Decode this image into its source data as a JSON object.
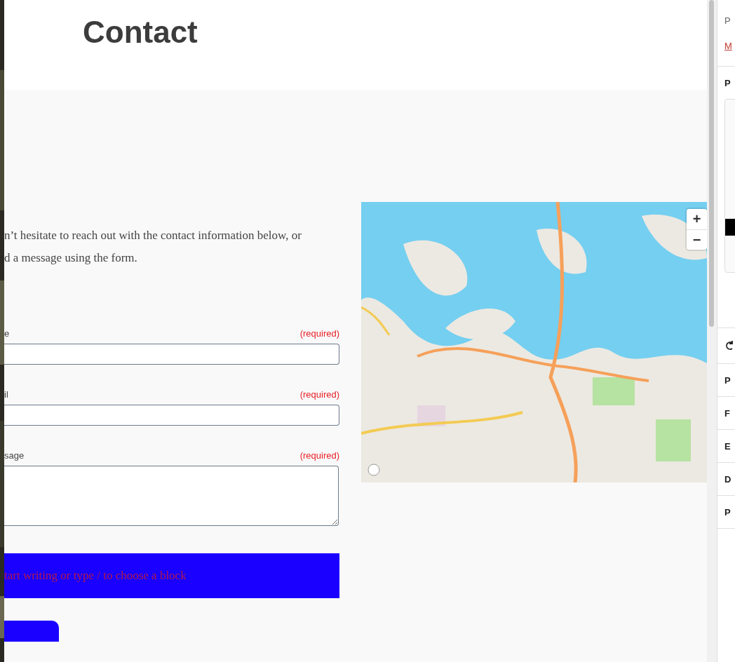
{
  "page": {
    "title": "Contact"
  },
  "intro": [
    "n’t hesitate to reach out with the contact information below, or",
    "d a message using the form."
  ],
  "fields": [
    {
      "kind": "input",
      "label": "e",
      "note": "(required)"
    },
    {
      "kind": "input",
      "label": "il",
      "note": "(required)"
    },
    {
      "kind": "textarea",
      "label": "sage",
      "note": "(required)"
    }
  ],
  "block_placeholder": "tart writing or type / to choose a block",
  "map": {
    "zoom_in": "+",
    "zoom_out": "−"
  },
  "sidebar": {
    "items": [
      {
        "kind": "text",
        "label": "P"
      },
      {
        "kind": "link",
        "label": "M"
      },
      {
        "kind": "heading",
        "label": "P"
      },
      {
        "kind": "preview"
      },
      {
        "kind": "icon"
      },
      {
        "kind": "heading",
        "label": "P"
      },
      {
        "kind": "heading",
        "label": "F"
      },
      {
        "kind": "heading",
        "label": "E"
      },
      {
        "kind": "heading",
        "label": "D"
      },
      {
        "kind": "heading",
        "label": "P"
      }
    ]
  }
}
